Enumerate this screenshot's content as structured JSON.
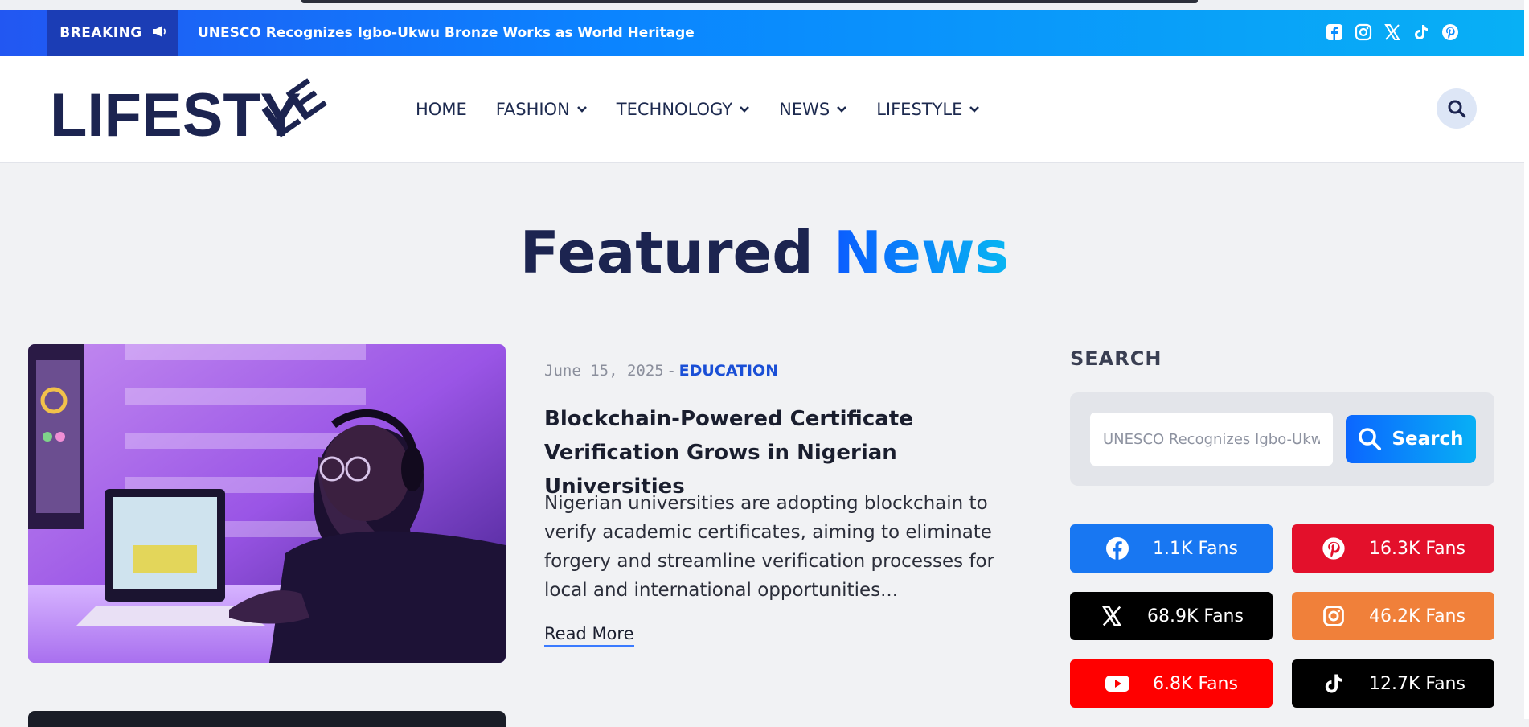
{
  "breaking": {
    "label": "BREAKING",
    "headline": "UNESCO Recognizes Igbo-Ukwu Bronze Works as World Heritage",
    "social_icons": [
      "facebook-icon",
      "instagram-icon",
      "x-icon",
      "tiktok-icon",
      "pinterest-icon"
    ]
  },
  "logo": {
    "text": "LIFESTY",
    "text_rotated": "LE"
  },
  "nav": {
    "home": "HOME",
    "fashion": "FASHION",
    "technology": "TECHNOLOGY",
    "news": "NEWS",
    "lifestyle": "LIFESTYLE"
  },
  "section": {
    "title_main": "Featured",
    "title_accent": "News"
  },
  "featured": {
    "date": "June 15, 2025",
    "separator": "-",
    "category": "EDUCATION",
    "title": "Blockchain-Powered Certificate Verification Grows in Nigerian Universities",
    "excerpt": "Nigerian universities are adopting blockchain to verify academic certificates, aiming to eliminate forgery and streamline verification processes for local and international opportunities...",
    "read_more": "Read More"
  },
  "sidebar": {
    "search_title": "SEARCH",
    "search_value": "UNESCO Recognizes Igbo-Ukwu B",
    "search_button": "Search",
    "fans": [
      {
        "network": "facebook",
        "label": "1.1K Fans",
        "color": "#1877f2"
      },
      {
        "network": "pinterest",
        "label": "16.3K Fans",
        "color": "#e3102b"
      },
      {
        "network": "x",
        "label": "68.9K Fans",
        "color": "#000000"
      },
      {
        "network": "instagram",
        "label": "46.2K Fans",
        "color": "#f0803a"
      },
      {
        "network": "youtube",
        "label": "6.8K Fans",
        "color": "#ff0000"
      },
      {
        "network": "tiktok",
        "label": "12.7K Fans",
        "color": "#000000"
      }
    ]
  },
  "colors": {
    "accent": "#0b66ff",
    "navy": "#1c2450"
  }
}
